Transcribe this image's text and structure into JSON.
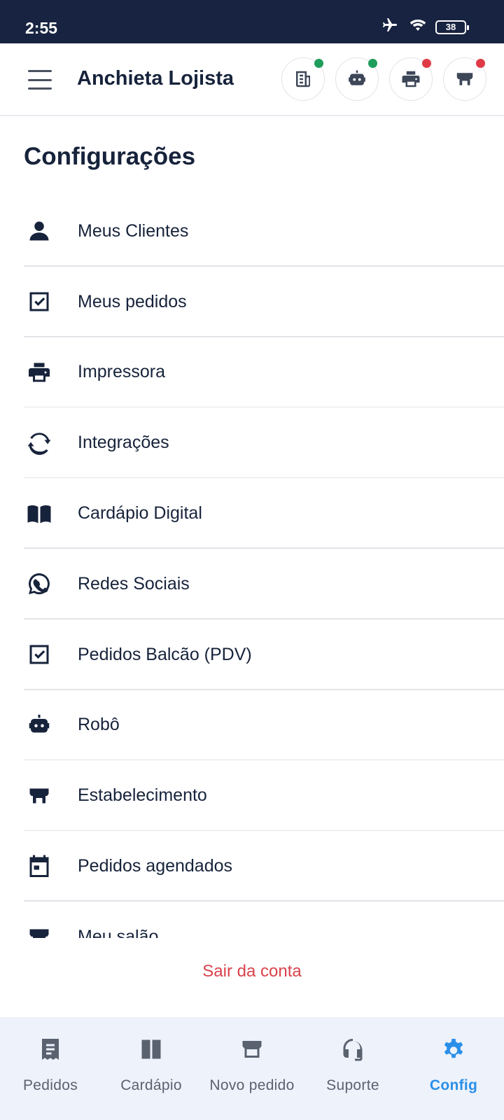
{
  "status_bar": {
    "time": "2:55",
    "battery": "38",
    "icons": [
      "airplane-icon",
      "wifi-icon",
      "battery-icon"
    ]
  },
  "app_bar": {
    "title": "Anchieta Lojista",
    "status_buttons": [
      {
        "icon": "receipt-icon",
        "dot_color": "#1f9d5c"
      },
      {
        "icon": "robot-icon",
        "dot_color": "#1f9d5c"
      },
      {
        "icon": "printer-icon",
        "dot_color": "#e03a47"
      },
      {
        "icon": "store-icon",
        "dot_color": "#e03a47"
      }
    ]
  },
  "page": {
    "title": "Configurações"
  },
  "settings": [
    {
      "label": "Meus Clientes",
      "icon": "person-icon"
    },
    {
      "label": "Meus pedidos",
      "icon": "checkbox-icon"
    },
    {
      "label": "Impressora",
      "icon": "printer-icon"
    },
    {
      "label": "Integrações",
      "icon": "sync-icon"
    },
    {
      "label": "Cardápio Digital",
      "icon": "book-icon"
    },
    {
      "label": "Redes Sociais",
      "icon": "whatsapp-icon"
    },
    {
      "label": "Pedidos Balcão (PDV)",
      "icon": "checkbox-icon"
    },
    {
      "label": "Robô",
      "icon": "robot-icon"
    },
    {
      "label": "Estabelecimento",
      "icon": "store-icon"
    },
    {
      "label": "Pedidos agendados",
      "icon": "calendar-icon"
    },
    {
      "label": "Meu salão",
      "icon": "store-icon"
    }
  ],
  "logout_label": "Sair da conta",
  "bottom_nav": [
    {
      "label": "Pedidos",
      "icon": "receipt-icon",
      "active": false
    },
    {
      "label": "Cardápio",
      "icon": "book-icon",
      "active": false
    },
    {
      "label": "Novo pedido",
      "icon": "store-icon",
      "active": false
    },
    {
      "label": "Suporte",
      "icon": "headset-icon",
      "active": false
    },
    {
      "label": "Config",
      "icon": "gear-icon",
      "active": true
    }
  ],
  "colors": {
    "primary_dark": "#172340",
    "accent": "#2a8fe8",
    "danger": "#d9434c",
    "online": "#1f9d5c",
    "offline": "#e03a47"
  }
}
